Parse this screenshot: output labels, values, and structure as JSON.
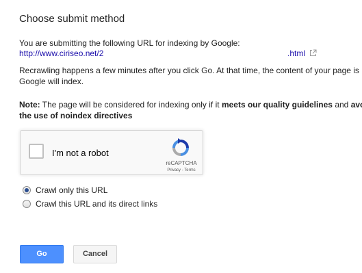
{
  "dialog": {
    "title": "Choose submit method",
    "intro": "You are submitting the following URL for indexing by Google:",
    "url_start": "http://www.ciriseo.net/2",
    "url_end": ".html",
    "recrawl_line1": "Recrawling happens a few minutes after you click Go. At that time, the content of your page is",
    "recrawl_line2": "Google will index.",
    "note_label": "Note:",
    "note_text": " The page will be considered for indexing only if it ",
    "note_bold1": "meets our quality guidelines",
    "note_and": " and ",
    "note_avo": "avo",
    "note_line2": "the use of noindex directives"
  },
  "captcha": {
    "label": "I'm not a robot",
    "brand": "reCAPTCHA",
    "links": "Privacy - Terms",
    "icon": "recaptcha-logo-icon"
  },
  "options": [
    {
      "label": "Crawl only this URL",
      "checked": true
    },
    {
      "label": "Crawl this URL and its direct links",
      "checked": false
    }
  ],
  "buttons": {
    "go": "Go",
    "cancel": "Cancel"
  },
  "colors": {
    "link": "#1a0dab",
    "go_button": "#4d90fe",
    "radio_dot": "#2a4d8f"
  }
}
